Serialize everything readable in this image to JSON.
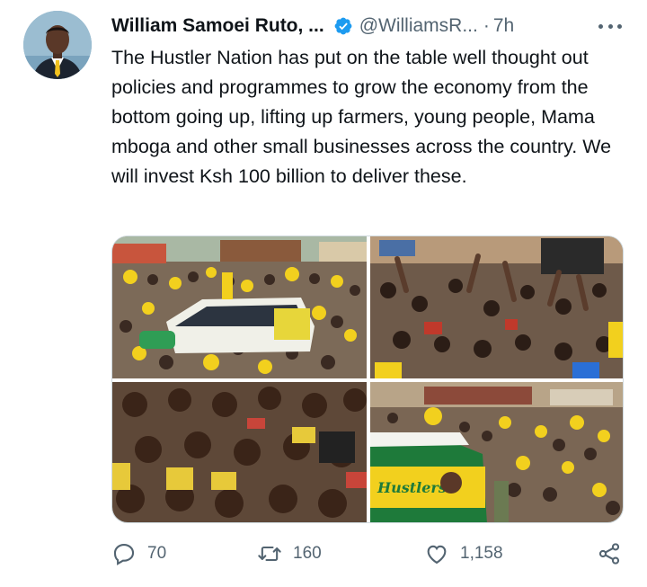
{
  "author": {
    "name": "William Samoei Ruto, ...",
    "handle": "@WilliamsR...",
    "separator": "·",
    "time": "7h"
  },
  "tweet": {
    "text": "The Hustler Nation has put on the table well thought out policies and programmes to grow the economy from the bottom going up, lifting up farmers, young people, Mama mboga and other small businesses across the country. We will invest Ksh 100 billion to deliver these."
  },
  "media": {
    "vehicle_decal": "Hustlers"
  },
  "actions": {
    "replies": "70",
    "retweets": "160",
    "likes": "1,158"
  },
  "icons": {
    "verified": "verified-badge-icon",
    "more": "more-icon",
    "reply": "reply-icon",
    "retweet": "retweet-icon",
    "like": "like-icon",
    "share": "share-icon"
  },
  "colors": {
    "verified": "#1d9bf0",
    "secondary_text": "#536471",
    "primary_text": "#0f1419",
    "campaign_yellow": "#f2d01e",
    "campaign_green": "#1f8a3a"
  }
}
